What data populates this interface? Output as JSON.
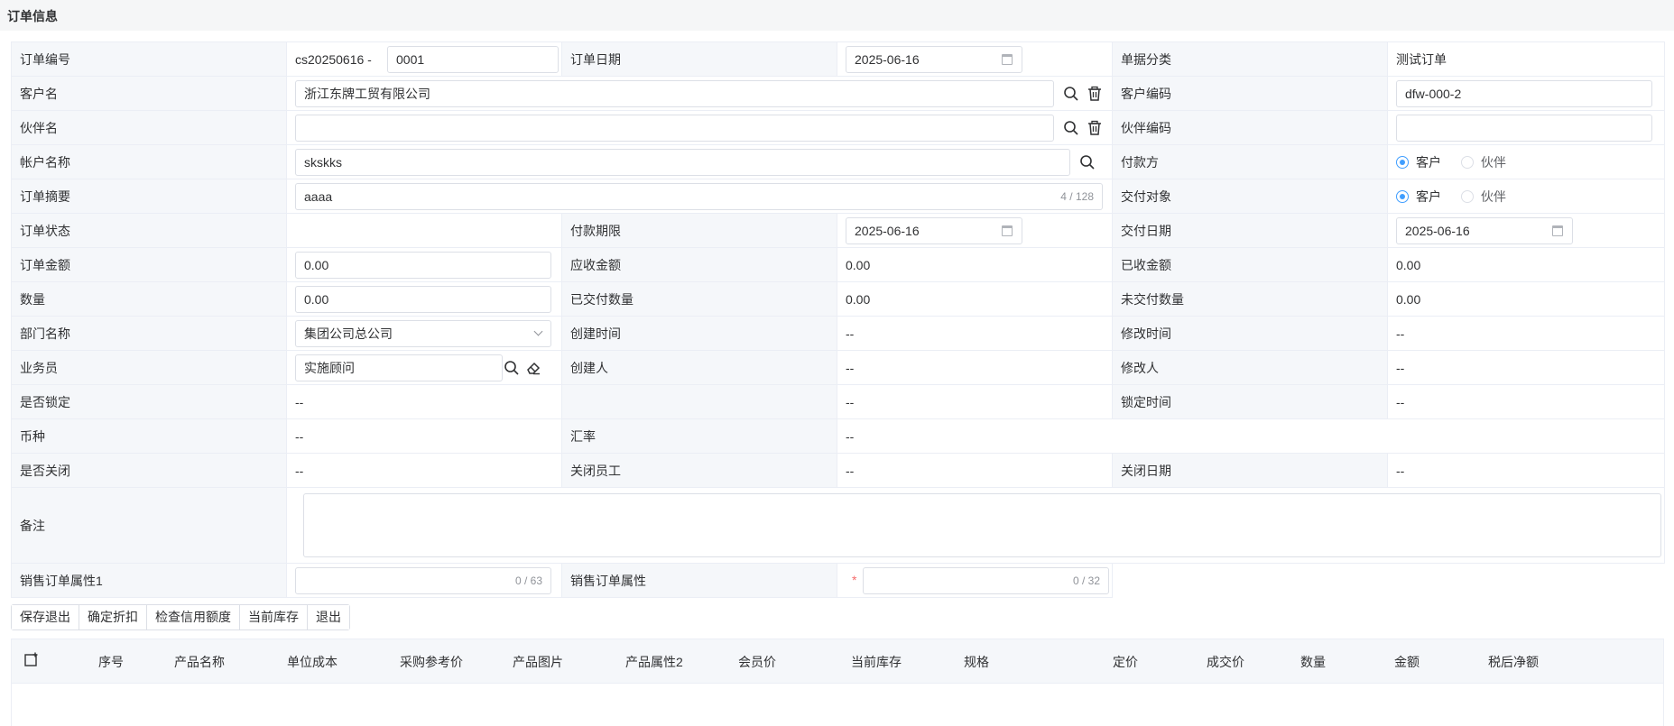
{
  "header": {
    "title": "订单信息"
  },
  "form": {
    "order_no": {
      "label": "订单编号",
      "prefix": "cs20250616 -",
      "value": "0001"
    },
    "order_date": {
      "label": "订单日期",
      "value": "2025-06-16"
    },
    "doc_category": {
      "label": "单据分类",
      "value": "测试订单"
    },
    "customer_name": {
      "label": "客户名",
      "value": "浙江东牌工贸有限公司"
    },
    "customer_code": {
      "label": "客户编码",
      "value": "dfw-000-2"
    },
    "partner_name": {
      "label": "伙伴名",
      "value": ""
    },
    "partner_code": {
      "label": "伙伴编码",
      "value": ""
    },
    "account_name": {
      "label": "帐户名称",
      "value": "skskks"
    },
    "payer": {
      "label": "付款方",
      "option1": "客户",
      "option2": "伙伴",
      "selected": "客户"
    },
    "order_summary": {
      "label": "订单摘要",
      "value": "aaaa",
      "counter": "4 / 128"
    },
    "delivery_target": {
      "label": "交付对象",
      "option1": "客户",
      "option2": "伙伴",
      "selected": "客户"
    },
    "order_status": {
      "label": "订单状态",
      "value": ""
    },
    "payment_deadline": {
      "label": "付款期限",
      "value": "2025-06-16"
    },
    "delivery_date": {
      "label": "交付日期",
      "value": "2025-06-16"
    },
    "order_amount": {
      "label": "订单金额",
      "value": "0.00"
    },
    "receivable": {
      "label": "应收金额",
      "value": "0.00"
    },
    "received": {
      "label": "已收金额",
      "value": "0.00"
    },
    "quantity": {
      "label": "数量",
      "value": "0.00"
    },
    "delivered_qty": {
      "label": "已交付数量",
      "value": "0.00"
    },
    "undelivered_qty": {
      "label": "未交付数量",
      "value": "0.00"
    },
    "department": {
      "label": "部门名称",
      "value": "集团公司总公司"
    },
    "created_time": {
      "label": "创建时间",
      "value": "--"
    },
    "modified_time": {
      "label": "修改时间",
      "value": "--"
    },
    "salesperson": {
      "label": "业务员",
      "value": "实施顾问"
    },
    "creator": {
      "label": "创建人",
      "value": "--"
    },
    "modifier": {
      "label": "修改人",
      "value": "--"
    },
    "is_locked": {
      "label": "是否锁定",
      "value": "--"
    },
    "lock_blank_value": "--",
    "lock_time": {
      "label": "锁定时间",
      "value": "--"
    },
    "currency": {
      "label": "币种",
      "value": "--"
    },
    "exchange_rate": {
      "label": "汇率",
      "value": "--"
    },
    "is_closed": {
      "label": "是否关闭",
      "value": "--"
    },
    "closed_by": {
      "label": "关闭员工",
      "value": "--"
    },
    "close_date": {
      "label": "关闭日期",
      "value": "--"
    },
    "remarks": {
      "label": "备注",
      "value": ""
    },
    "sales_attr1": {
      "label": "销售订单属性1",
      "counter": "0 / 63"
    },
    "sales_attr": {
      "label": "销售订单属性",
      "required_mark": "*",
      "counter": "0 / 32"
    }
  },
  "actions": {
    "save_exit": "保存退出",
    "confirm_discount": "确定折扣",
    "check_credit": "检查信用额度",
    "current_stock": "当前库存",
    "exit": "退出"
  },
  "grid": {
    "columns": [
      "序号",
      "产品名称",
      "单位成本",
      "采购参考价",
      "产品图片",
      "产品属性2",
      "会员价",
      "当前库存",
      "规格",
      "定价",
      "成交价",
      "数量",
      "金额",
      "税后净额"
    ]
  },
  "colors": {
    "accent": "#409eff",
    "label_bg": "#f5f7fa",
    "border": "#ebeef5",
    "required": "#f56c6c"
  }
}
